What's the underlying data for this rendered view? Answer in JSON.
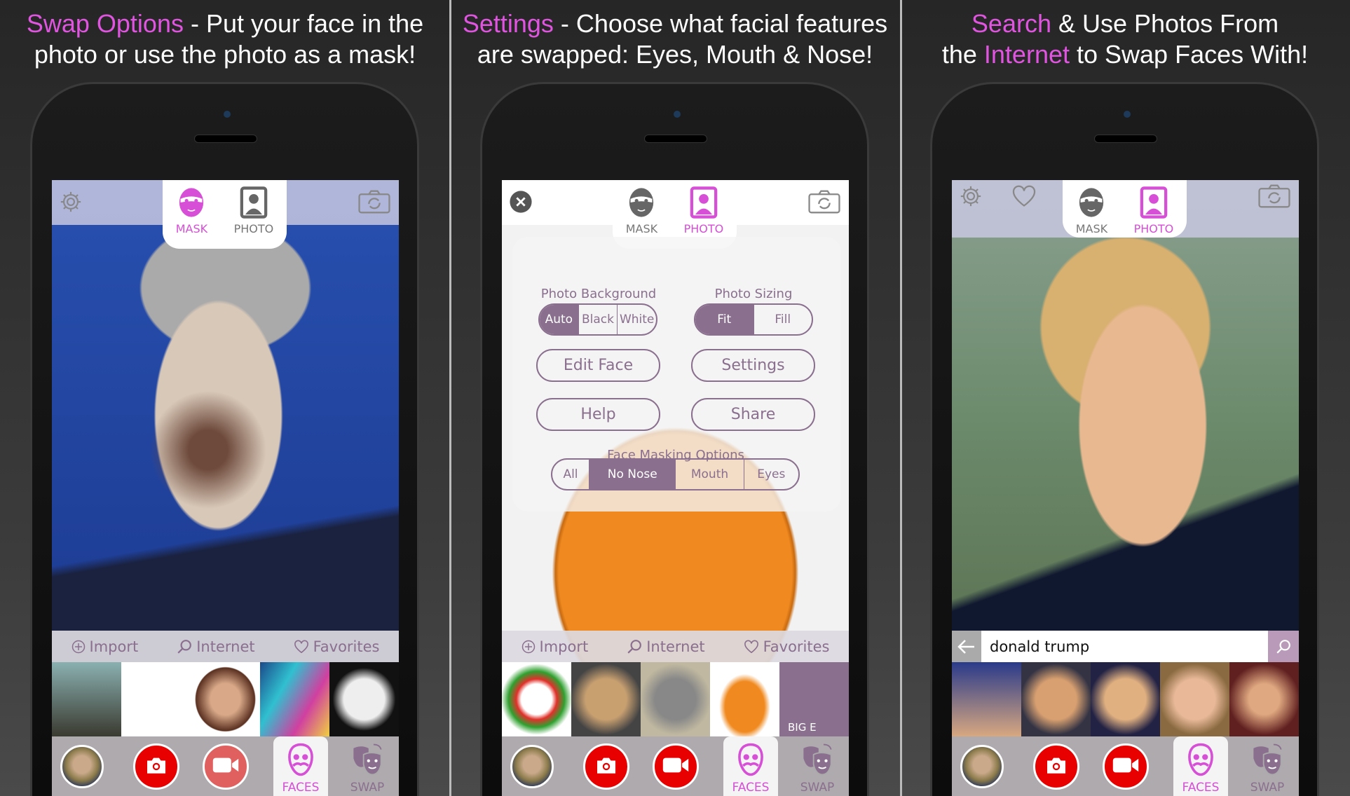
{
  "colors": {
    "accent": "#e055e0",
    "ui_purple": "#8a6f8e",
    "record_red": "#e80000"
  },
  "panels": [
    {
      "headline_highlight": "Swap Options",
      "headline_rest": " - Put your face in the",
      "headline_line2_pre": "photo or use the photo as a mask!",
      "headline_line2_hl": "",
      "headline_line2_post": "",
      "variant": "mask",
      "top": {
        "tabs": [
          {
            "label": "MASK",
            "icon": "mask-icon",
            "active": true
          },
          {
            "label": "PHOTO",
            "icon": "photo-portrait-icon",
            "active": false
          }
        ],
        "left_icons": [
          "gear-icon"
        ],
        "right_icon": "camera-rotate-icon"
      },
      "actions": {
        "import": "Import",
        "internet": "Internet",
        "favorites": "Favorites"
      },
      "thumbs": [
        "Lincoln portrait",
        "baby",
        "woman",
        "painted face",
        "skull makeup"
      ],
      "toolbar": {
        "faces": "FACES",
        "swap": "SWAP"
      }
    },
    {
      "headline_highlight": "Settings",
      "headline_rest": " - Choose what facial features",
      "headline_line2_pre": "are swapped: Eyes, Mouth & Nose!",
      "headline_line2_hl": "",
      "headline_line2_post": "",
      "variant": "settings",
      "top": {
        "tabs": [
          {
            "label": "MASK",
            "icon": "mask-icon",
            "active": false
          },
          {
            "label": "PHOTO",
            "icon": "photo-portrait-icon",
            "active": true
          }
        ],
        "left_icons": [
          "close-icon"
        ],
        "right_icon": "camera-rotate-icon"
      },
      "settings": {
        "photo_background": {
          "label": "Photo Background",
          "options": [
            "Auto",
            "Black",
            "White"
          ],
          "selected": "Auto"
        },
        "photo_sizing": {
          "label": "Photo Sizing",
          "options": [
            "Fit",
            "Fill"
          ],
          "selected": "Fit"
        },
        "buttons": [
          "Edit Face",
          "Settings",
          "Help",
          "Share"
        ],
        "face_masking": {
          "label": "Face Masking Options",
          "options": [
            "All",
            "No Nose",
            "Mouth",
            "Eyes"
          ],
          "selected": "No Nose"
        }
      },
      "actions": {
        "import": "Import",
        "internet": "Internet",
        "favorites": "Favorites"
      },
      "thumbs": [
        "clown",
        "dog",
        "cat",
        "pumpkin",
        "BIG E"
      ],
      "thumb_caption": "BIG E",
      "toolbar": {
        "faces": "FACES",
        "swap": "SWAP"
      }
    },
    {
      "headline_highlight": "Search",
      "headline_rest": " & Use Photos From",
      "headline_line2_pre": "the ",
      "headline_line2_hl": "Internet",
      "headline_line2_post": " to Swap Faces With!",
      "variant": "search",
      "top": {
        "tabs": [
          {
            "label": "MASK",
            "icon": "mask-icon",
            "active": false
          },
          {
            "label": "PHOTO",
            "icon": "photo-portrait-icon",
            "active": true
          }
        ],
        "left_icons": [
          "gear-icon",
          "heart-icon"
        ],
        "right_icon": "camera-rotate-icon"
      },
      "search": {
        "query": "donald trump"
      },
      "thumbs": [
        "result 1",
        "result 2",
        "result 3",
        "result 4",
        "result 5"
      ],
      "toolbar": {
        "faces": "FACES",
        "swap": "SWAP"
      }
    }
  ]
}
